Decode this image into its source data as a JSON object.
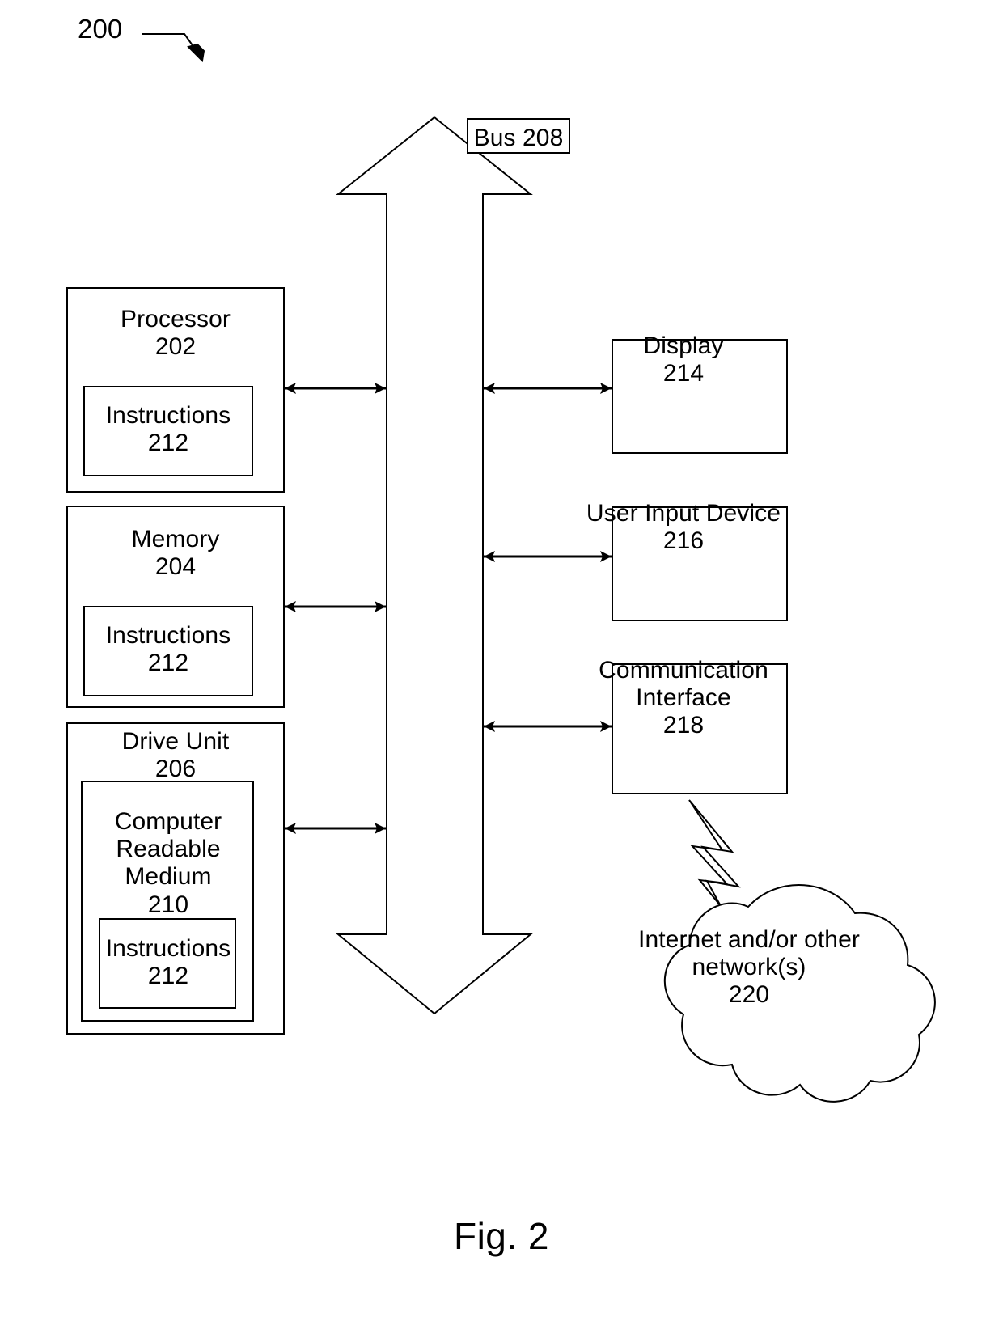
{
  "figure": {
    "caption": "Fig. 2",
    "system_reference": "200"
  },
  "bus": {
    "label": "Bus 208",
    "name": "Bus",
    "number": "208"
  },
  "blocks": {
    "processor": {
      "name": "Processor",
      "number": "202",
      "label": "Processor\n202",
      "child": {
        "name": "Instructions",
        "number": "212",
        "label": "Instructions\n212"
      }
    },
    "memory": {
      "name": "Memory",
      "number": "204",
      "label": "Memory\n204",
      "child": {
        "name": "Instructions",
        "number": "212",
        "label": "Instructions\n212"
      }
    },
    "drive_unit": {
      "name": "Drive Unit",
      "number": "206",
      "label": "Drive Unit\n206",
      "child": {
        "name": "Computer Readable Medium",
        "number": "210",
        "label": "Computer\nReadable\nMedium\n210",
        "child": {
          "name": "Instructions",
          "number": "212",
          "label": "Instructions\n212"
        }
      }
    },
    "display": {
      "name": "Display",
      "number": "214",
      "label": "Display\n214"
    },
    "user_input_device": {
      "name": "User Input Device",
      "number": "216",
      "label": "User Input Device\n216"
    },
    "communication_interface": {
      "name": "Communication Interface",
      "number": "218",
      "label": "Communication\nInterface\n218"
    },
    "network_cloud": {
      "name": "Internet and/or other network(s)",
      "number": "220",
      "label": "Internet and/or other\nnetwork(s)\n220"
    }
  },
  "connectors": [
    {
      "from": "processor",
      "to": "bus",
      "style": "double-arrow"
    },
    {
      "from": "memory",
      "to": "bus",
      "style": "double-arrow"
    },
    {
      "from": "drive_unit",
      "to": "bus",
      "style": "double-arrow"
    },
    {
      "from": "bus",
      "to": "display",
      "style": "double-arrow"
    },
    {
      "from": "bus",
      "to": "user_input_device",
      "style": "double-arrow"
    },
    {
      "from": "bus",
      "to": "communication_interface",
      "style": "double-arrow"
    },
    {
      "from": "communication_interface",
      "to": "network_cloud",
      "style": "lightning-bolt"
    }
  ],
  "colors": {
    "stroke": "#000000",
    "background": "#ffffff"
  }
}
